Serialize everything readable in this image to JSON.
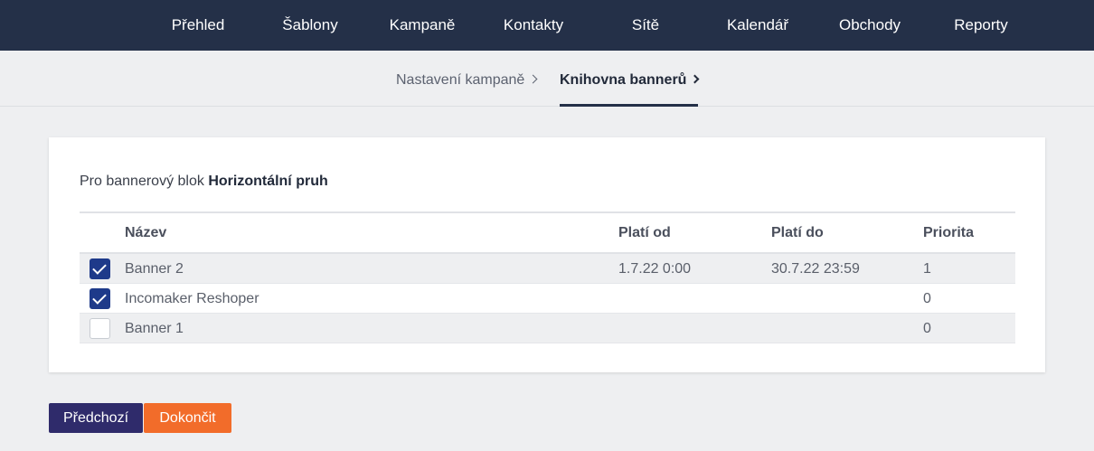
{
  "topnav": {
    "items": [
      "Přehled",
      "Šablony",
      "Kampaně",
      "Kontakty",
      "Sítě",
      "Kalendář",
      "Obchody",
      "Reporty"
    ]
  },
  "breadcrumb": {
    "steps": [
      {
        "label": "Nastavení kampaně",
        "active": false
      },
      {
        "label": "Knihovna bannerů",
        "active": true
      }
    ]
  },
  "block": {
    "prefix": "Pro bannerový blok",
    "name": "Horizontální pruh"
  },
  "table": {
    "headers": {
      "name": "Název",
      "from": "Platí od",
      "to": "Platí do",
      "priority": "Priorita"
    },
    "rows": [
      {
        "checked": true,
        "name": "Banner 2",
        "from": "1.7.22 0:00",
        "to": "30.7.22 23:59",
        "priority": "1"
      },
      {
        "checked": true,
        "name": "Incomaker Reshoper",
        "from": "",
        "to": "",
        "priority": "0"
      },
      {
        "checked": false,
        "name": "Banner 1",
        "from": "",
        "to": "",
        "priority": "0"
      }
    ]
  },
  "buttons": {
    "prev": "Předchozí",
    "finish": "Dokončit"
  },
  "colors": {
    "nav_bg": "#243048",
    "prev_button": "#2f2b6b",
    "finish_button": "#f26c2a",
    "checkbox_checked": "#1e3a8a"
  }
}
